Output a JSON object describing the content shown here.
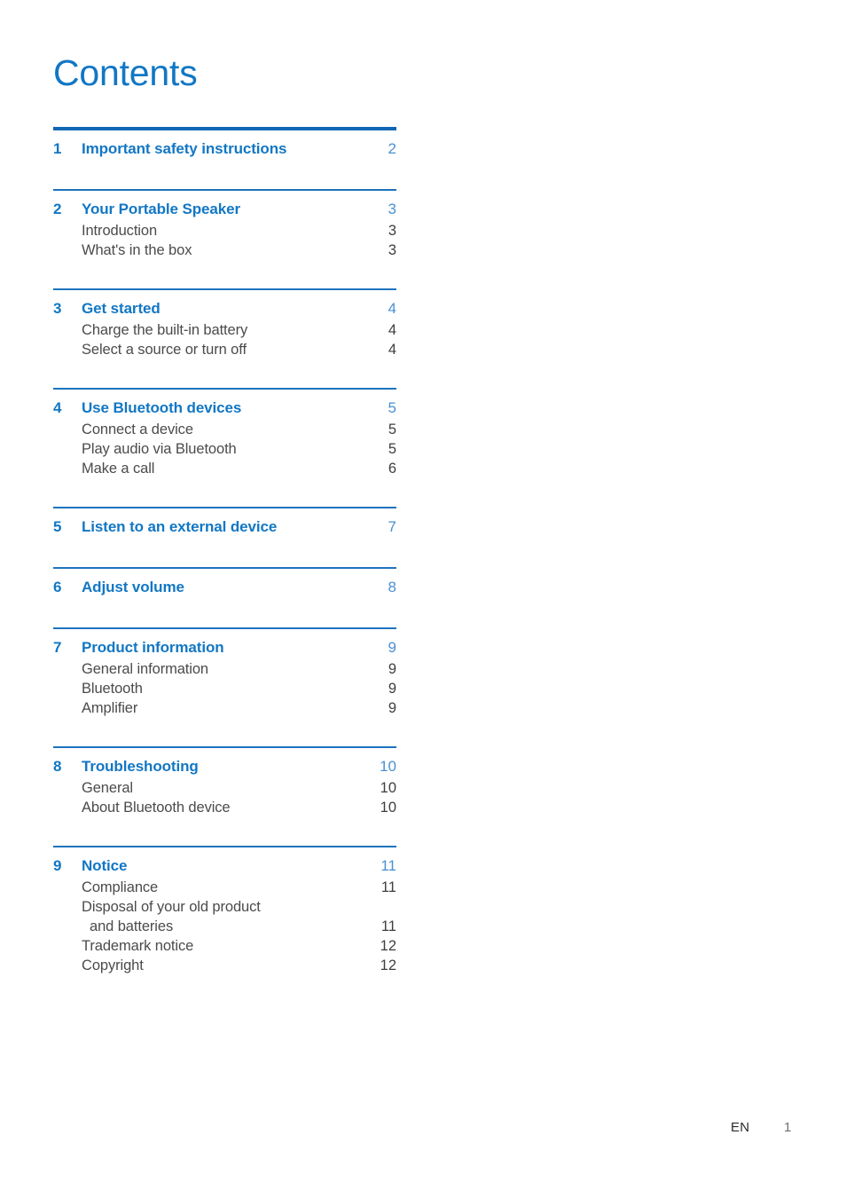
{
  "document": {
    "title": "Contents",
    "accent_color": "#1277c4",
    "rule_color": "#1e73be",
    "subentry_color": "#4b4b4b"
  },
  "footer": {
    "language": "EN",
    "page_number": "1"
  },
  "sections": [
    {
      "number": "1",
      "title": "Important safety instructions",
      "page": "2",
      "entries": []
    },
    {
      "number": "2",
      "title": "Your Portable Speaker",
      "page": "3",
      "entries": [
        {
          "label": "Introduction",
          "page": "3"
        },
        {
          "label": "What's in the box",
          "page": "3"
        }
      ]
    },
    {
      "number": "3",
      "title": "Get started",
      "page": "4",
      "entries": [
        {
          "label": "Charge the built-in battery",
          "page": "4"
        },
        {
          "label": "Select a source or turn off",
          "page": "4"
        }
      ]
    },
    {
      "number": "4",
      "title": "Use Bluetooth devices",
      "page": "5",
      "entries": [
        {
          "label": "Connect a device",
          "page": "5"
        },
        {
          "label": "Play audio via Bluetooth",
          "page": "5"
        },
        {
          "label": "Make a call",
          "page": "6"
        }
      ]
    },
    {
      "number": "5",
      "title": "Listen to an external device",
      "page": "7",
      "entries": []
    },
    {
      "number": "6",
      "title": "Adjust volume",
      "page": "8",
      "entries": []
    },
    {
      "number": "7",
      "title": "Product information",
      "page": "9",
      "entries": [
        {
          "label": "General information",
          "page": "9"
        },
        {
          "label": "Bluetooth",
          "page": "9"
        },
        {
          "label": "Amplifier",
          "page": "9"
        }
      ]
    },
    {
      "number": "8",
      "title": "Troubleshooting",
      "page": "10",
      "entries": [
        {
          "label": "General",
          "page": "10"
        },
        {
          "label": "About Bluetooth device",
          "page": "10"
        }
      ]
    },
    {
      "number": "9",
      "title": "Notice",
      "page": "11",
      "entries": [
        {
          "label": "Compliance",
          "page": "11"
        },
        {
          "label": "Disposal of your old product",
          "page": ""
        },
        {
          "label": "and batteries",
          "page": "11",
          "continuation": true
        },
        {
          "label": "Trademark notice",
          "page": "12"
        },
        {
          "label": "Copyright",
          "page": "12"
        }
      ]
    }
  ]
}
